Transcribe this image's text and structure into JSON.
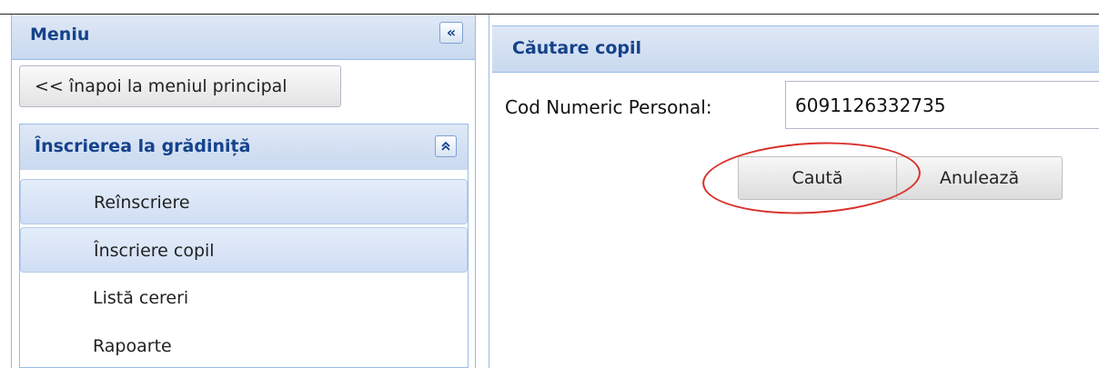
{
  "menu": {
    "title": "Meniu",
    "collapse_icon": "«",
    "back_label": "<< înapoi la meniul principal",
    "section": {
      "title": "Înscrierea la grădiniță",
      "toggle_icon": "⌃",
      "items": [
        {
          "label": "Reînscriere",
          "highlighted": true
        },
        {
          "label": "Înscriere copil",
          "highlighted": true
        },
        {
          "label": "Listă cereri",
          "highlighted": false
        },
        {
          "label": "Rapoarte",
          "highlighted": false
        }
      ]
    }
  },
  "search": {
    "title": "Căutare copil",
    "cnp_label": "Cod Numeric Personal:",
    "cnp_value": "6091126332735",
    "search_label": "Caută",
    "cancel_label": "Anulează"
  },
  "colors": {
    "header_text": "#15428b",
    "panel_border": "#99bbe8",
    "highlight_ring": "#d9302b"
  }
}
